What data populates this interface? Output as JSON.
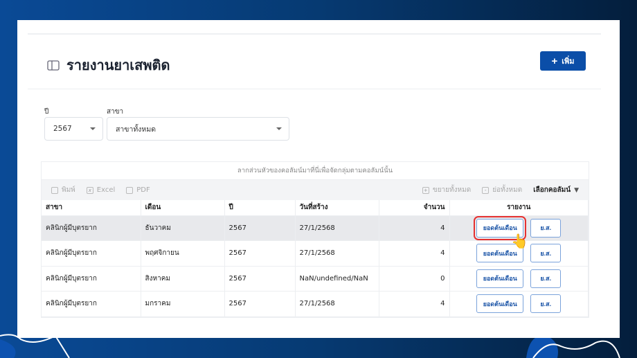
{
  "page": {
    "title": "รายงานยาเสพติด",
    "add_label": "เพิ่ม"
  },
  "filters": {
    "year_label": "ปี",
    "year_value": "2567",
    "branch_label": "สาขา",
    "branch_value": "สาขาทั้งหมด"
  },
  "grid": {
    "group_hint": "ลากส่วนหัวของคอลัมน์มาที่นี่เพื่อจัดกลุ่มตามคอลัมน์นั้น",
    "toolbar": {
      "print": "พิมพ์",
      "excel": "Excel",
      "pdf": "PDF",
      "expand_all": "ขยายทั้งหมด",
      "collapse_all": "ย่อทั้งหมด",
      "choose_columns": "เลือกคอลัมน์"
    },
    "columns": [
      "สาขา",
      "เดือน",
      "ปี",
      "วันที่สร้าง",
      "จำนวน",
      "รายงาน"
    ],
    "rows": [
      {
        "branch": "คลินิกผู้มีบุตรยาก",
        "month": "ธันวาคม",
        "year": "2567",
        "created": "27/1/2568",
        "count": "4",
        "btn1": "ยอดต้นเดือน",
        "btn2": "ย.ส."
      },
      {
        "branch": "คลินิกผู้มีบุตรยาก",
        "month": "พฤศจิกายน",
        "year": "2567",
        "created": "27/1/2568",
        "count": "4",
        "btn1": "ยอดต้นเดือน",
        "btn2": "ย.ส."
      },
      {
        "branch": "คลินิกผู้มีบุตรยาก",
        "month": "สิงหาคม",
        "year": "2567",
        "created": "NaN/undefined/NaN",
        "count": "0",
        "btn1": "ยอดต้นเดือน",
        "btn2": "ย.ส."
      },
      {
        "branch": "คลินิกผู้มีบุตรยาก",
        "month": "มกราคม",
        "year": "2567",
        "created": "27/1/2568",
        "count": "4",
        "btn1": "ยอดต้นเดือน",
        "btn2": "ย.ส."
      }
    ]
  },
  "colors": {
    "accent": "#0b4ea8",
    "highlight": "#e53030"
  }
}
